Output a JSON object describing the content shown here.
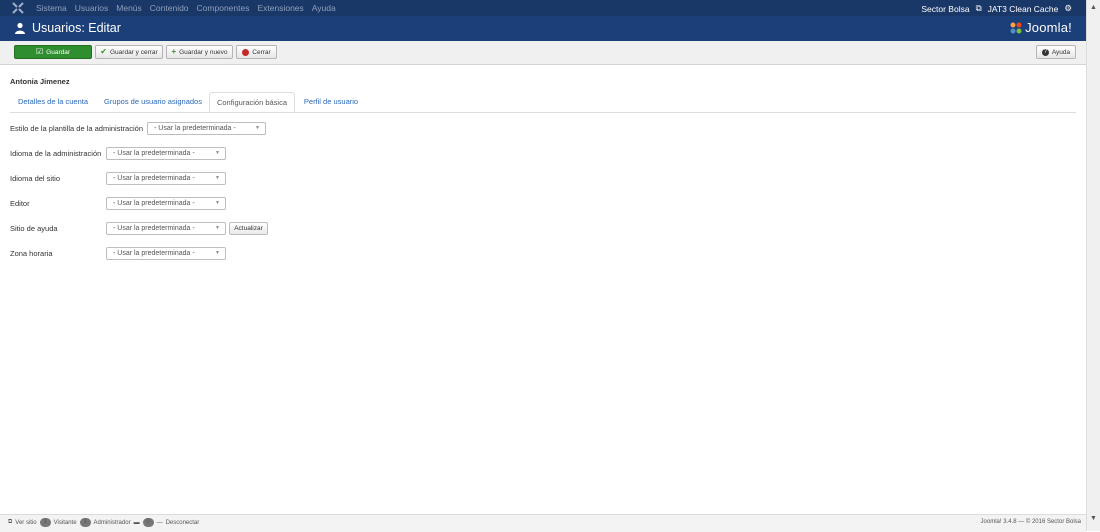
{
  "topbar": {
    "menu": [
      "Sistema",
      "Usuarios",
      "Menús",
      "Contenido",
      "Componentes",
      "Extensiones",
      "Ayuda"
    ],
    "site_link": "Sector Bolsa",
    "cache_label": "JAT3 Clean Cache"
  },
  "header": {
    "title": "Usuarios: Editar",
    "brand": "Joomla!"
  },
  "toolbar": {
    "save": "Guardar",
    "save_close": "Guardar y cerrar",
    "save_new": "Guardar y nuevo",
    "close": "Cerrar",
    "help": "Ayuda"
  },
  "user": {
    "name": "Antonia Jimenez"
  },
  "tabs": [
    {
      "label": "Detalles de la cuenta",
      "active": false
    },
    {
      "label": "Grupos de usuario asignados",
      "active": false
    },
    {
      "label": "Configuración básica",
      "active": true
    },
    {
      "label": "Perfil de usuario",
      "active": false
    }
  ],
  "form": {
    "rows": [
      {
        "label": "Estilo de la plantilla de la administración",
        "value": "- Usar la predeterminada -"
      },
      {
        "label": "Idioma de la administración",
        "value": "- Usar la predeterminada -"
      },
      {
        "label": "Idioma del sitio",
        "value": "- Usar la predeterminada -"
      },
      {
        "label": "Editor",
        "value": "- Usar la predeterminada -"
      },
      {
        "label": "Sitio de ayuda",
        "value": "- Usar la predeterminada -"
      },
      {
        "label": "Zona horaria",
        "value": "- Usar la predeterminada -"
      }
    ],
    "refresh_button": "Actualizar"
  },
  "statusbar": {
    "view_site": "Ver sitio",
    "visitors_count": "1",
    "visitors_label": "Visitante",
    "admins_count": "1",
    "admins_label": "Administrador",
    "messages_count": "0",
    "logout": "Desconectar",
    "copyright": "Joomla! 3.4.8 — © 2016 Sector Bolsa"
  },
  "colors": {
    "topbar": "#1a3867",
    "header": "#1b3f78",
    "save_button": "#2f8f2f",
    "link": "#2a69b8"
  }
}
